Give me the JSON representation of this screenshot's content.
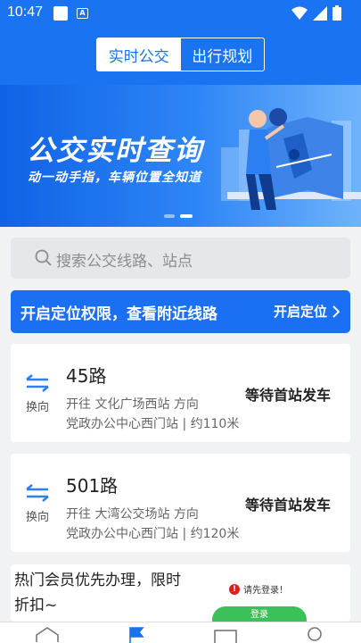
{
  "status_bar": {
    "time": "10:47",
    "notif_badge": "A"
  },
  "header": {
    "tabs": [
      {
        "label": "实时公交",
        "active": true
      },
      {
        "label": "出行规划",
        "active": false
      }
    ]
  },
  "banner": {
    "title": "公交实时查询",
    "subtitle": "动一动手指，车辆位置全知道",
    "page_count": 2,
    "active_page": 2
  },
  "search": {
    "placeholder": "搜索公交线路、站点"
  },
  "location_bar": {
    "text": "开启定位权限，查看附近线路",
    "button": "开启定位"
  },
  "swap_label": "换向",
  "routes": [
    {
      "name": "45路",
      "direction": "开往 文化广场西站 方向",
      "stop": "党政办公中心西门站 | 约110米",
      "status": "等待首站发车"
    },
    {
      "name": "501路",
      "direction": "开往 大湾公交场站 方向",
      "stop": "党政办公中心西门站 | 约120米",
      "status": "等待首站发车"
    }
  ],
  "promo": {
    "text": "热门会员优先办理，限时折扣~",
    "tip": "请先登录！",
    "login": "登录"
  },
  "colors": {
    "primary": "#1a73f0",
    "login_green": "#3cc15a",
    "error_red": "#e02020"
  }
}
